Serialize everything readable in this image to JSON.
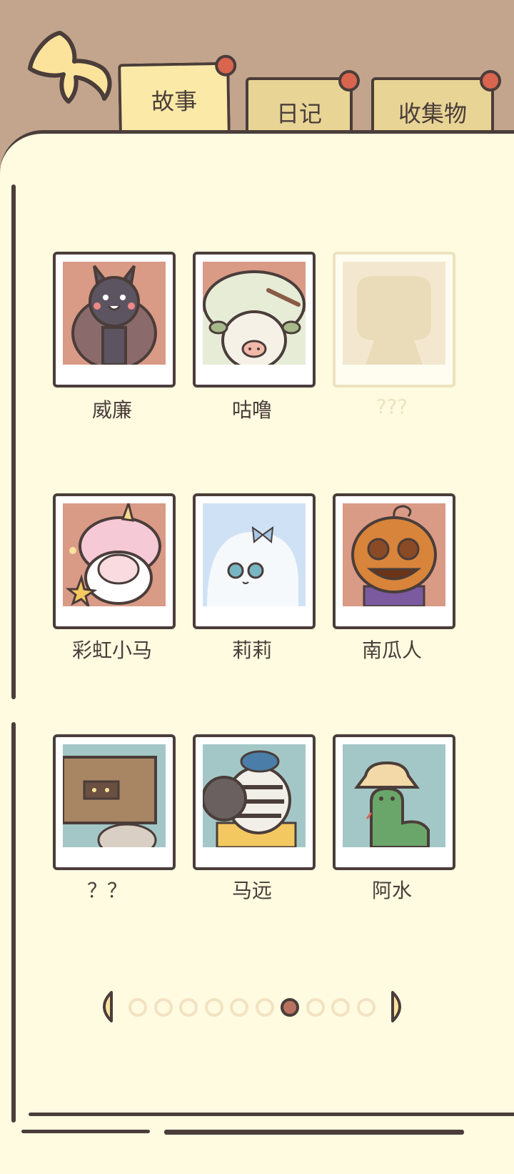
{
  "tabs": [
    {
      "label": "故事",
      "active": true
    },
    {
      "label": "日记",
      "active": false
    },
    {
      "label": "收集物",
      "active": false
    }
  ],
  "characters": [
    {
      "name": "威廉",
      "locked": false,
      "bg": "#d99a86"
    },
    {
      "name": "咕噜",
      "locked": false,
      "bg": "#d99a86"
    },
    {
      "name": "???",
      "locked": true,
      "bg": "#f3e8cf"
    },
    {
      "name": "彩虹小马",
      "locked": false,
      "bg": "#d99a86"
    },
    {
      "name": "莉莉",
      "locked": false,
      "bg": "#cfe2f5"
    },
    {
      "name": "南瓜人",
      "locked": false,
      "bg": "#d99a86"
    },
    {
      "name": "？？",
      "locked": false,
      "bg": "#a3c7c6"
    },
    {
      "name": "马远",
      "locked": false,
      "bg": "#a3c7c6"
    },
    {
      "name": "阿水",
      "locked": false,
      "bg": "#a3c7c6"
    }
  ],
  "pagination": {
    "total_pages": 10,
    "current_page": 7
  },
  "colors": {
    "outline": "#4a3d3a",
    "paper": "#fefbe0",
    "header_bg": "#c2a58c",
    "pin": "#d9654e",
    "active_dot": "#b9725f"
  }
}
